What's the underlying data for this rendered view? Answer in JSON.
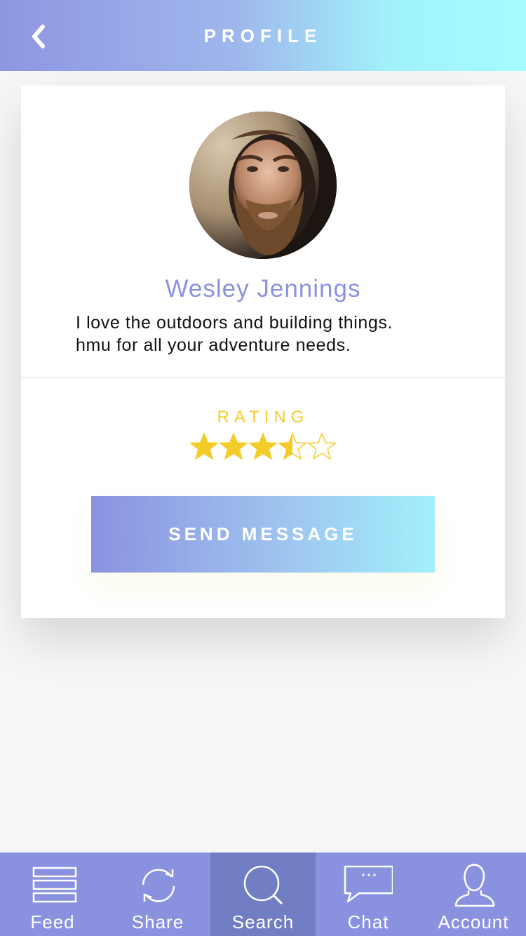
{
  "header": {
    "title": "PROFILE",
    "back_icon": "chevron-left-icon"
  },
  "profile": {
    "name": "Wesley Jennings",
    "bio_line1": "I love the outdoors and building things.",
    "bio_line2": "hmu for all your adventure needs."
  },
  "rating": {
    "label": "RATING",
    "value": 3.5,
    "max": 5,
    "color": "#f4cc2a"
  },
  "actions": {
    "send_label": "SEND MESSAGE"
  },
  "tabs": [
    {
      "label": "Feed",
      "icon": "list-icon",
      "active": false
    },
    {
      "label": "Share",
      "icon": "refresh-icon",
      "active": false
    },
    {
      "label": "Search",
      "icon": "search-icon",
      "active": true
    },
    {
      "label": "Chat",
      "icon": "chat-bubble-icon",
      "active": false
    },
    {
      "label": "Account",
      "icon": "user-icon",
      "active": false
    }
  ],
  "colors": {
    "accent": "#8a92e0",
    "accent_light": "#a4fbff",
    "name": "#8a93df",
    "star": "#f4cc2a",
    "tab_active": "#727ec4"
  }
}
